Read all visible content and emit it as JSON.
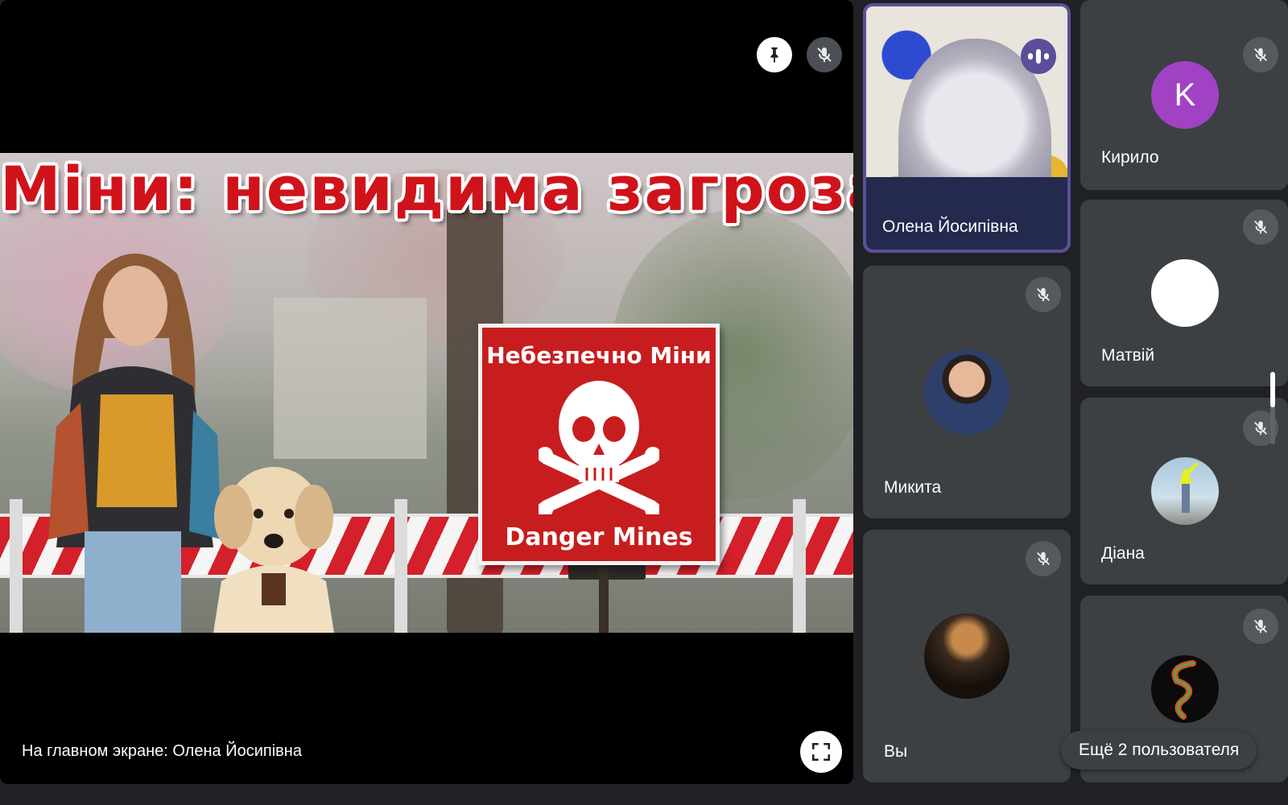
{
  "stage": {
    "slide_title": "Міни: невидима загроза",
    "sign_top": "Небезпечно Міни",
    "sign_bottom": "Danger Mines",
    "caption": "На главном экране: Олена Йосипівна",
    "pin_icon": "pin-icon",
    "mic_icon": "mic-off-icon",
    "fullscreen_icon": "fullscreen-icon"
  },
  "participants": [
    {
      "name": "Олена Йосипівна",
      "speaking": true,
      "video": true
    },
    {
      "name": "Кирило",
      "avatar_letter": "K",
      "avatar_color": "#a142c4",
      "muted": true
    },
    {
      "name": "Матвій",
      "avatar_color": "#ffffff",
      "muted": true
    },
    {
      "name": "Микита",
      "muted": true
    },
    {
      "name": "Діана",
      "muted": true
    },
    {
      "name": "Вы",
      "muted": true
    },
    {
      "name": "",
      "muted": true
    }
  ],
  "more": {
    "label": "Ещё 2 пользователя"
  },
  "colors": {
    "background": "#202124",
    "tile": "#3c4043",
    "accent": "#5b4e9a",
    "danger_red": "#c71d1f"
  }
}
